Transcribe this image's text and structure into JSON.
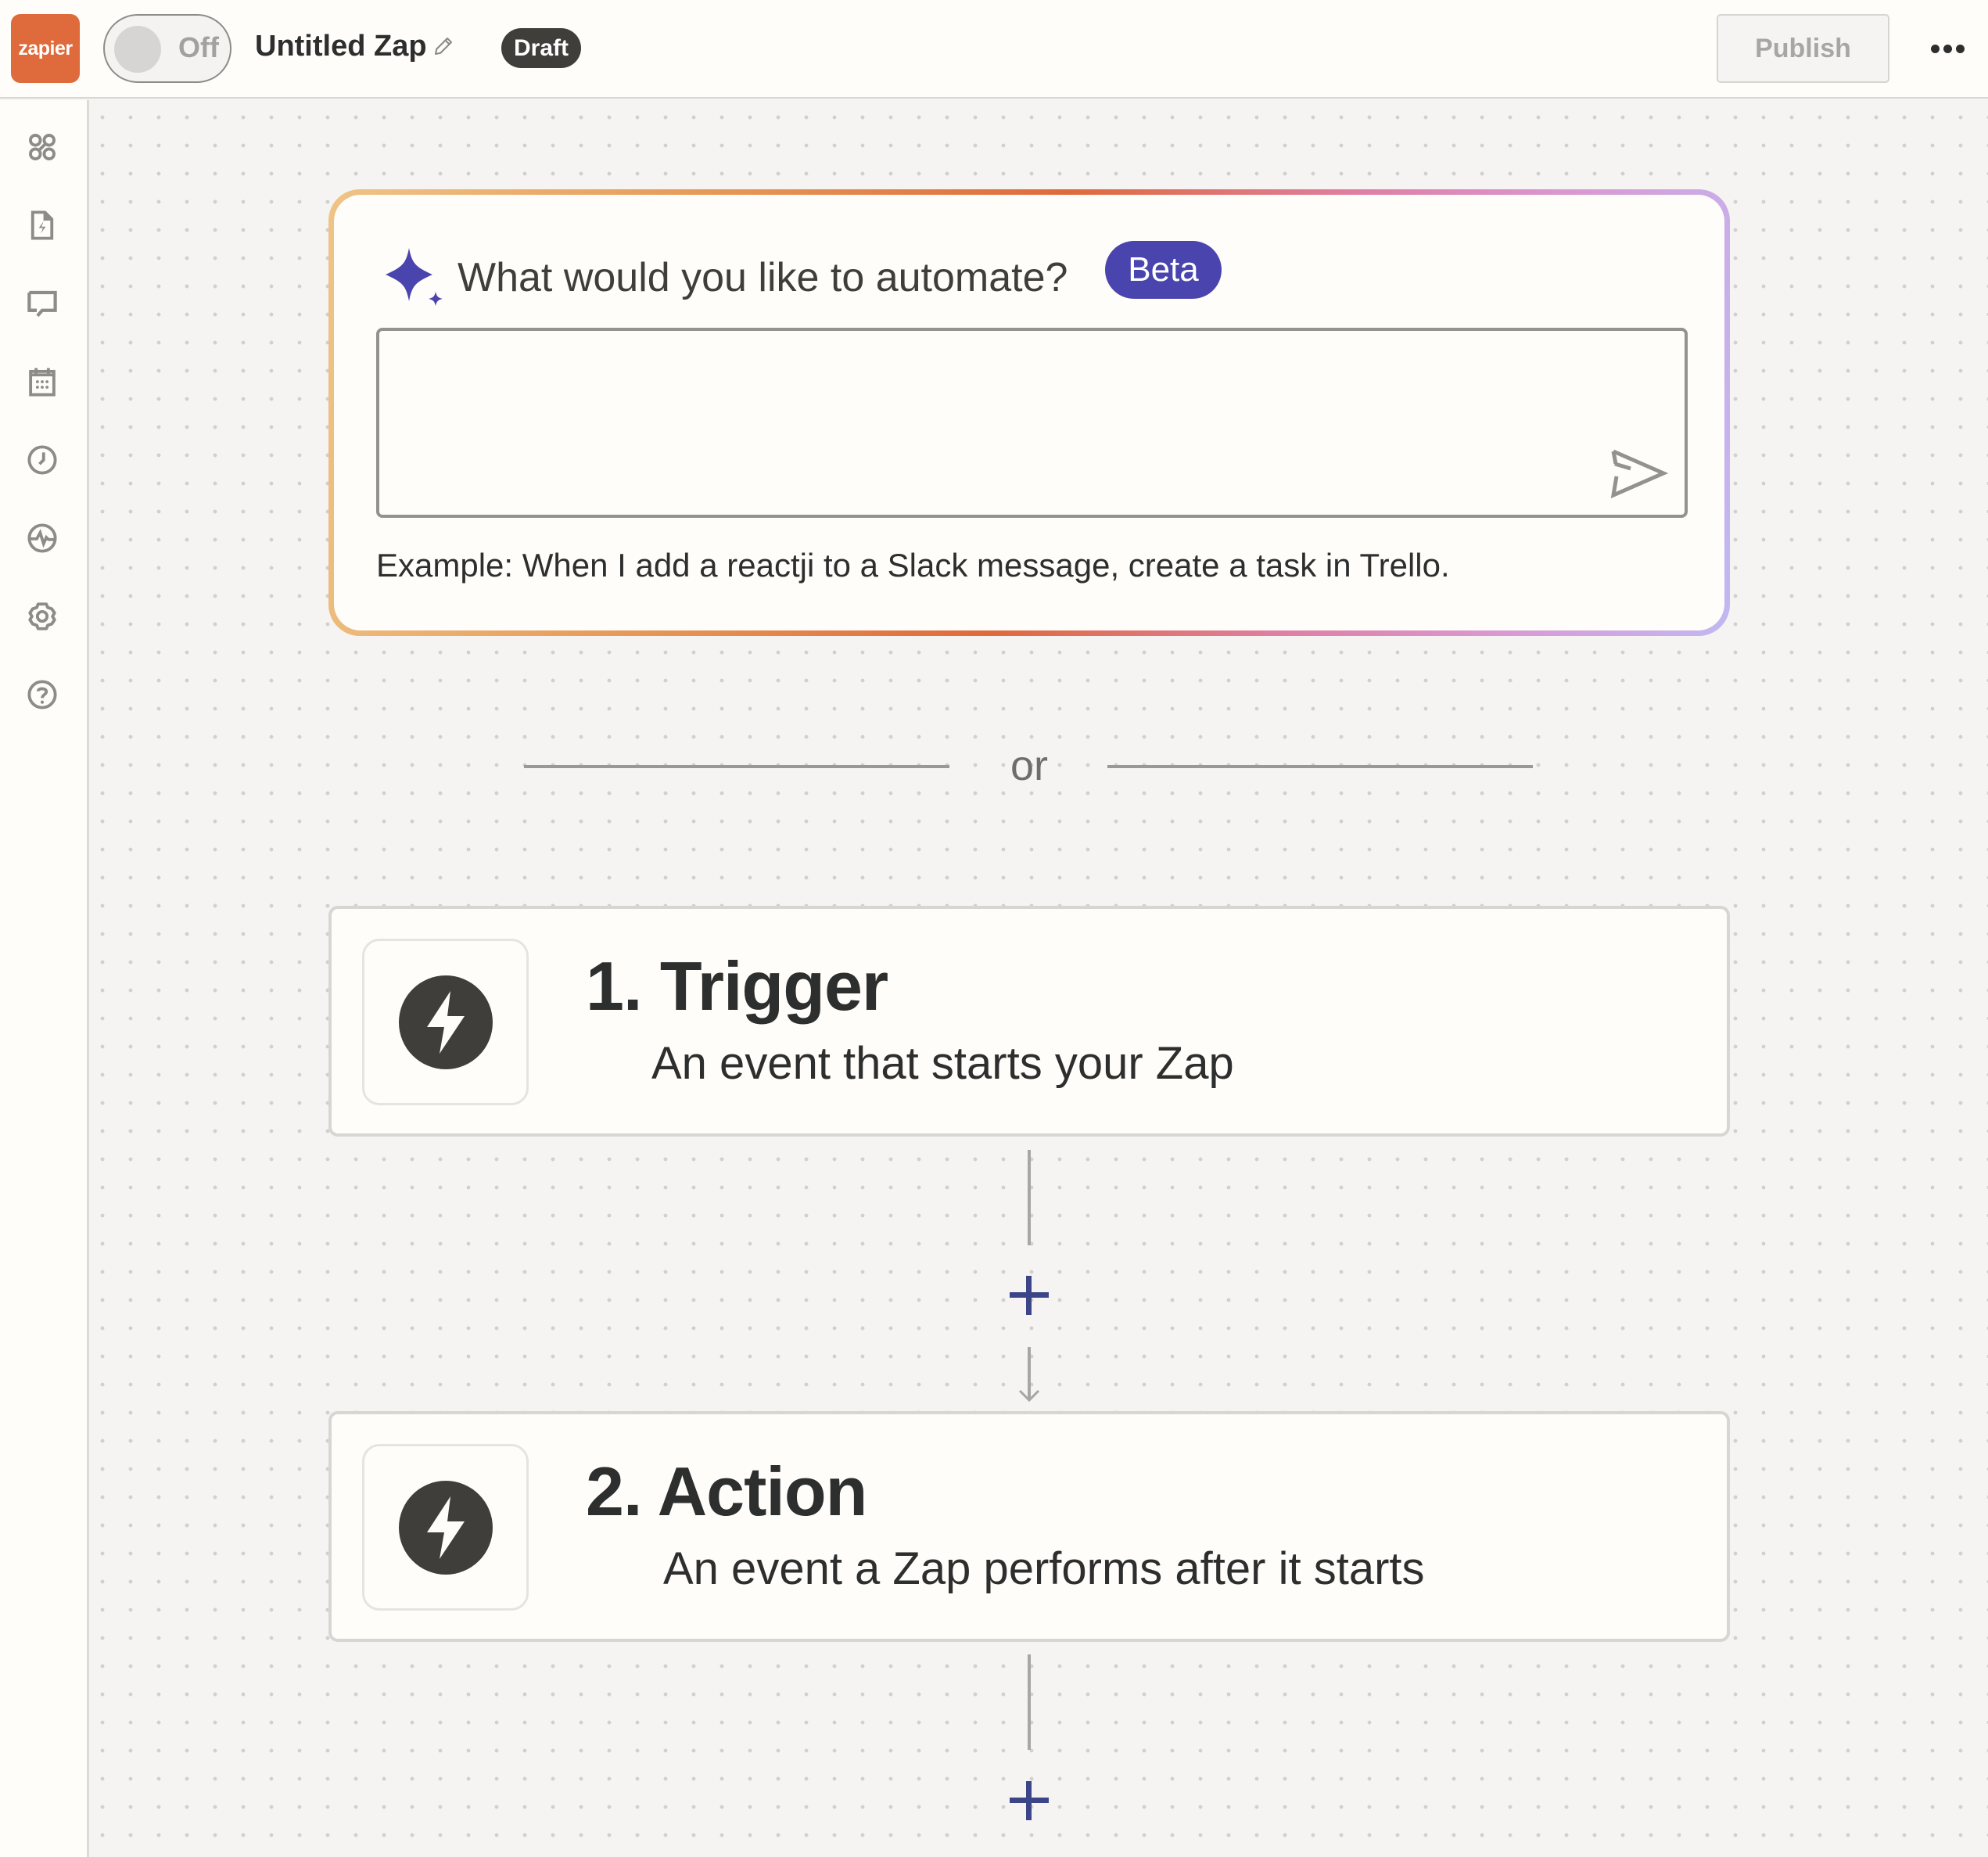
{
  "header": {
    "logo_text": "zapier",
    "toggle_label": "Off",
    "zap_title": "Untitled Zap",
    "status_badge": "Draft",
    "publish_label": "Publish",
    "more_icon": "more-horizontal-icon"
  },
  "sidebar": {
    "items": [
      {
        "name": "apps",
        "icon": "apps-icon"
      },
      {
        "name": "zaps",
        "icon": "zap-file-icon"
      },
      {
        "name": "chat",
        "icon": "chat-icon"
      },
      {
        "name": "calendar",
        "icon": "calendar-icon"
      },
      {
        "name": "history",
        "icon": "clock-icon"
      },
      {
        "name": "activity",
        "icon": "activity-icon"
      },
      {
        "name": "settings",
        "icon": "gear-icon"
      },
      {
        "name": "help",
        "icon": "help-icon"
      }
    ]
  },
  "ai_prompt": {
    "title": "What would you like to automate?",
    "badge": "Beta",
    "input_value": "",
    "input_placeholder": "",
    "example": "Example: When I add a reactji to a Slack message, create a task in Trello.",
    "accent_color": "#4a45ae"
  },
  "divider": {
    "label": "or"
  },
  "steps": [
    {
      "title": "1. Trigger",
      "subtitle": "An event that starts your Zap"
    },
    {
      "title": "2. Action",
      "subtitle": "An event a Zap performs after it starts"
    }
  ],
  "colors": {
    "brand": "#df6a3c",
    "accent": "#4a45ae",
    "add_step": "#3d4589",
    "badge_dark": "#403e3b"
  }
}
